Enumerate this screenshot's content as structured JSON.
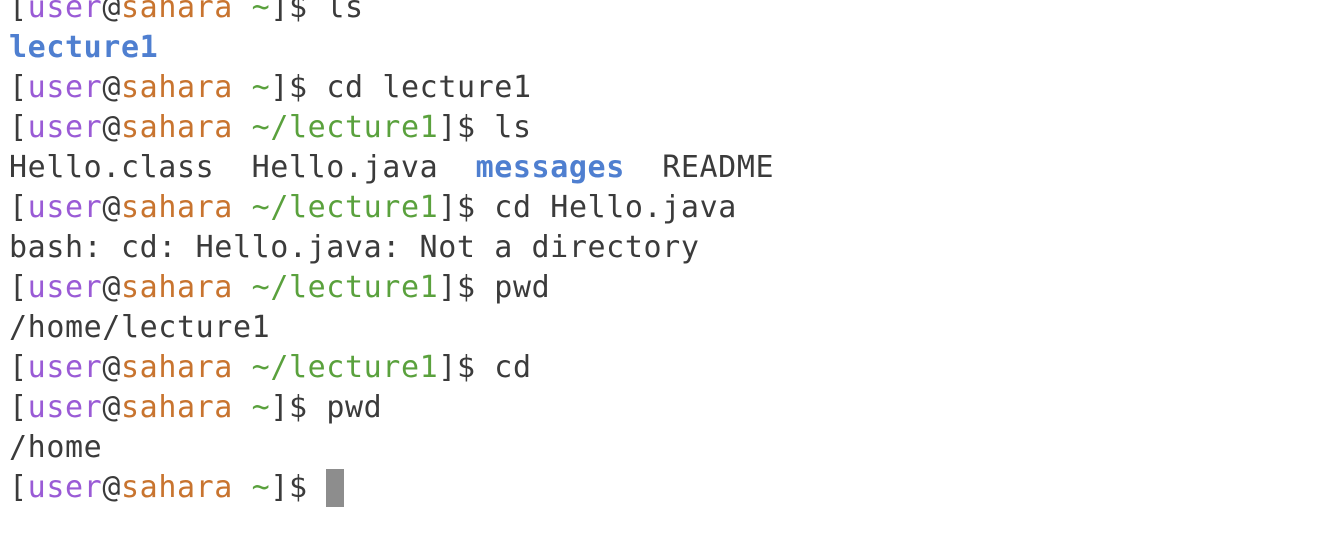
{
  "prompt": {
    "open_bracket": "[",
    "user": "user",
    "at": "@",
    "host": "sahara",
    "close_bracket": "]",
    "dollar": "$"
  },
  "lines": [
    {
      "type": "prompt",
      "path": "~",
      "command": "ls"
    },
    {
      "type": "output",
      "items": [
        {
          "text": "lecture1",
          "kind": "directory"
        }
      ]
    },
    {
      "type": "prompt",
      "path": "~",
      "command": "cd lecture1"
    },
    {
      "type": "prompt",
      "path": "~/lecture1",
      "command": "ls"
    },
    {
      "type": "output",
      "items": [
        {
          "text": "Hello.class",
          "kind": "file"
        },
        {
          "text": "Hello.java",
          "kind": "file"
        },
        {
          "text": "messages",
          "kind": "directory"
        },
        {
          "text": "README",
          "kind": "file"
        }
      ]
    },
    {
      "type": "prompt",
      "path": "~/lecture1",
      "command": "cd Hello.java"
    },
    {
      "type": "output",
      "items": [
        {
          "text": "bash: cd: Hello.java: Not a directory",
          "kind": "text"
        }
      ]
    },
    {
      "type": "prompt",
      "path": "~/lecture1",
      "command": "pwd"
    },
    {
      "type": "output",
      "items": [
        {
          "text": "/home/lecture1",
          "kind": "text"
        }
      ]
    },
    {
      "type": "prompt",
      "path": "~/lecture1",
      "command": "cd"
    },
    {
      "type": "prompt",
      "path": "~",
      "command": "pwd"
    },
    {
      "type": "output",
      "items": [
        {
          "text": "/home",
          "kind": "text"
        }
      ]
    },
    {
      "type": "prompt",
      "path": "~",
      "command": "",
      "cursor": true
    }
  ],
  "colors": {
    "user": "#9a5bd6",
    "host": "#c8742f",
    "path": "#5aa13d",
    "directory": "#4f7fd0",
    "text": "#3b3b3b",
    "cursor": "#8d8d8d",
    "background": "#ffffff"
  }
}
